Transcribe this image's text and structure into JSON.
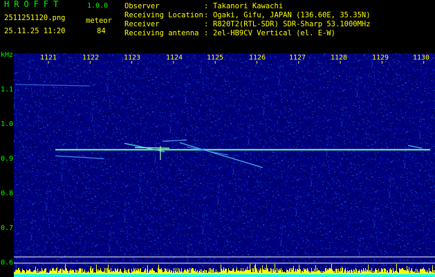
{
  "header": {
    "app_name": "HROFFT",
    "app_version": "1.0.0",
    "file_name": "2511251120.png",
    "mode_label": "meteor",
    "datetime": "25.11.25 11:20",
    "meteor_count": "84",
    "info": [
      {
        "label": "Observer",
        "sep": ":",
        "value": "Takanori Kawachi"
      },
      {
        "label": "Receiving Location",
        "sep": ":",
        "value": "Ogaki, Gifu, JAPAN (136.60E, 35.35N)"
      },
      {
        "label": "Receiver",
        "sep": ":",
        "value": "R820T2(RTL-SDR) SDR-Sharp 53.1000MHz"
      },
      {
        "label": "Receiving antenna",
        "sep": ":",
        "value": "2el-HB9CV Vertical (el. E-W)"
      }
    ]
  },
  "axis": {
    "y_unit": "kHz",
    "y_labels": [
      "1.1",
      "1.0",
      "0.9",
      "0.8",
      "0.7",
      "0.6"
    ],
    "x_labels": [
      "1121",
      "1122",
      "1123",
      "1124",
      "1125",
      "1126",
      "1127",
      "1128",
      "1129",
      "1130"
    ]
  },
  "colors": {
    "header_text_green": "#00ff00",
    "header_text_yellow": "#ffff00",
    "background": "#00008a",
    "carrier": "#aaffaa",
    "activity_bar": "#ffff00",
    "baseline": "#00ffff"
  }
}
